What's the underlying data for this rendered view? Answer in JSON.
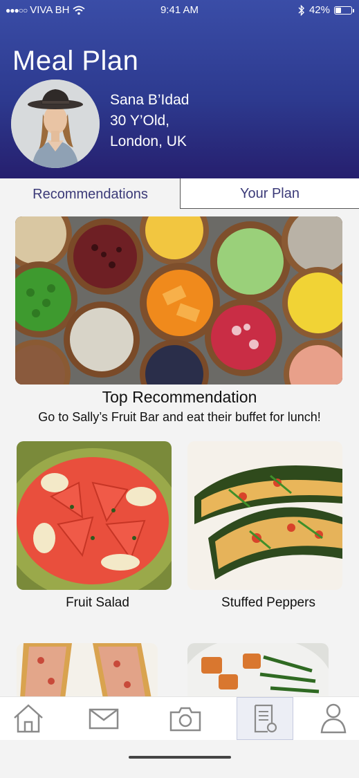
{
  "status_bar": {
    "signal_dots": "●●●○○",
    "carrier": "VIVA BH",
    "time": "9:41 AM",
    "battery_percent": "42%",
    "battery_level": 0.42
  },
  "header": {
    "title": "Meal Plan",
    "profile": {
      "name": "Sana B’Idad",
      "age": "30 Y’Old,",
      "location": "London, UK"
    }
  },
  "tabs": [
    {
      "label": "Recommendations",
      "active": true
    },
    {
      "label": "Your Plan",
      "active": false
    }
  ],
  "top_recommendation": {
    "title": "Top Recommendation",
    "description": "Go to Sally’s Fruit Bar and eat their buffet for lunch!"
  },
  "cards": [
    {
      "label": "Fruit Salad"
    },
    {
      "label": "Stuffed Peppers"
    },
    {
      "label": ""
    },
    {
      "label": ""
    }
  ],
  "nav": [
    {
      "icon": "home-icon",
      "active": false
    },
    {
      "icon": "mail-icon",
      "active": false
    },
    {
      "icon": "camera-icon",
      "active": false
    },
    {
      "icon": "meal-plan-icon",
      "active": true
    },
    {
      "icon": "profile-icon",
      "active": false
    }
  ],
  "colors": {
    "header_top": "#3a4da7",
    "header_bottom": "#261f6e",
    "tab_text": "#3b3a78",
    "icon_gray": "#8a8a8a"
  }
}
